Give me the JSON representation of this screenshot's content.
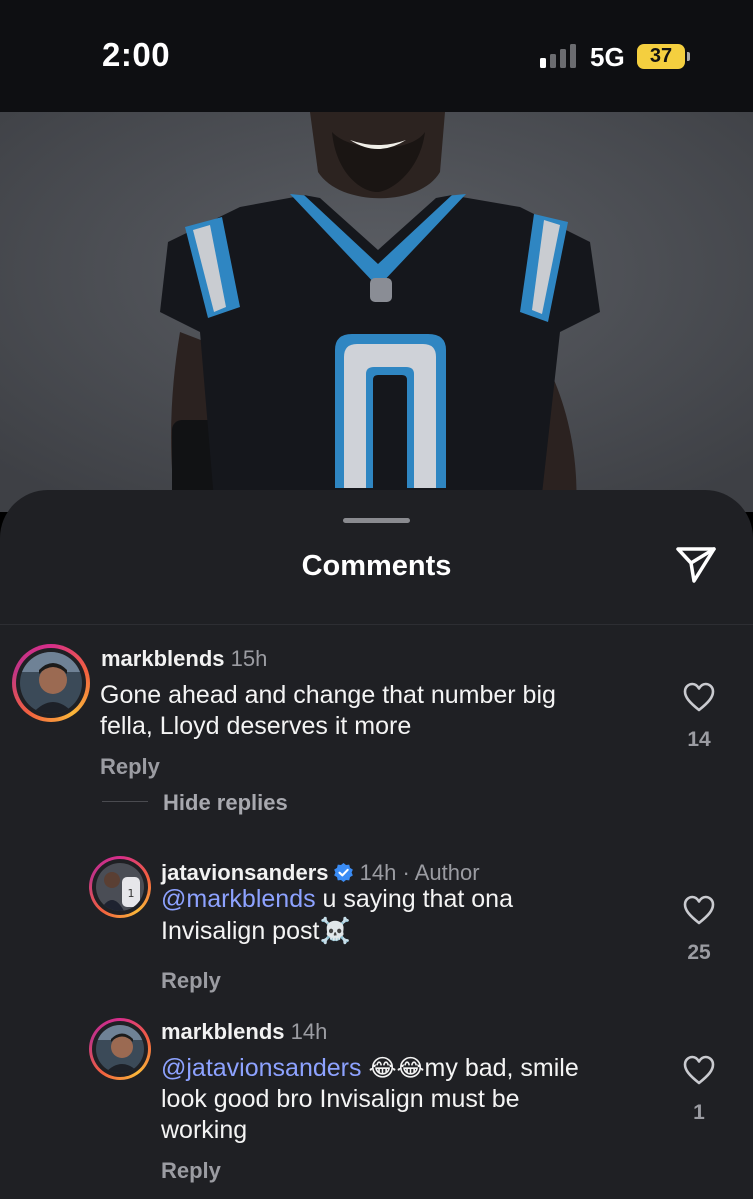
{
  "status_bar": {
    "time": "2:00",
    "network": "5G",
    "battery": "37",
    "battery_color": "#f4cf3f"
  },
  "post_image": {
    "jersey_number": "0"
  },
  "sheet": {
    "title": "Comments",
    "share_icon": "paper-plane-icon"
  },
  "comments": [
    {
      "username": "markblends",
      "time": "15h",
      "lines": [
        "Gone ahead and change that number big",
        "fella, Lloyd deserves it more"
      ],
      "reply_label": "Reply",
      "likes": "14"
    }
  ],
  "hide_replies_label": "Hide replies",
  "replies": [
    {
      "username": "jatavionsanders",
      "verified": true,
      "time": "14h",
      "separator": "·",
      "tag": "Author",
      "mention": "@markblends",
      "line1_rest": " u saying that ona",
      "line2": "Invisalign post",
      "line2_emoji": "☠️",
      "reply_label": "Reply",
      "likes": "25"
    },
    {
      "username": "markblends",
      "time": "14h",
      "mention": "@jatavionsanders",
      "emoji": "😂😂",
      "line1_rest": "my bad, smile",
      "line2": "look good bro Invisalign must be",
      "line3": "working",
      "reply_label": "Reply",
      "likes": "1"
    }
  ],
  "colors": {
    "sheet_bg": "#1f2024",
    "mention": "#8da2ff",
    "muted": "#9b9ca2",
    "verified": "#3a8cf5"
  }
}
